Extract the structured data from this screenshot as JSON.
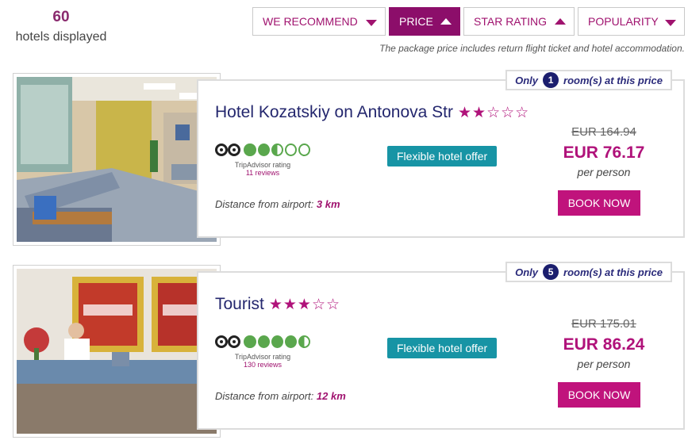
{
  "summary": {
    "count": "60",
    "label": "hotels displayed"
  },
  "sort": {
    "we_recommend": "WE RECOMMEND",
    "price": "PRICE",
    "star_rating": "STAR RATING",
    "popularity": "POPULARITY",
    "active": "price"
  },
  "note": "The package price includes return flight ticket and hotel accommodation.",
  "hotels": [
    {
      "name": "Hotel Kozatskiy on Antonova Str",
      "stars_filled": "★★",
      "stars_empty": "☆☆☆",
      "rooms_prefix": "Only",
      "rooms_count": "1",
      "rooms_suffix": "room(s) at this price",
      "tripadvisor_label": "TripAdvisor rating",
      "reviews": "11 reviews",
      "tripadvisor_score": 2.5,
      "flexible": "Flexible hotel offer",
      "distance_label": "Distance from airport:",
      "distance": "3 km",
      "old_price": "EUR 164.94",
      "price": "EUR 76.17",
      "per_person": "per person",
      "book": "BOOK NOW",
      "photo_icon": "hotel-lobby-image"
    },
    {
      "name": "Tourist",
      "stars_filled": "★★★",
      "stars_empty": "☆☆",
      "rooms_prefix": "Only",
      "rooms_count": "5",
      "rooms_suffix": "room(s) at this price",
      "tripadvisor_label": "TripAdvisor rating",
      "reviews": "130 reviews",
      "tripadvisor_score": 4.5,
      "flexible": "Flexible hotel offer",
      "distance_label": "Distance from airport:",
      "distance": "12 km",
      "old_price": "EUR 175.01",
      "price": "EUR 86.24",
      "per_person": "per person",
      "book": "BOOK NOW",
      "photo_icon": "hotel-reception-image"
    }
  ],
  "colors": {
    "accent": "#b0127a",
    "active_sort": "#8c0e6a",
    "teal": "#1794a5",
    "title": "#24276e"
  }
}
